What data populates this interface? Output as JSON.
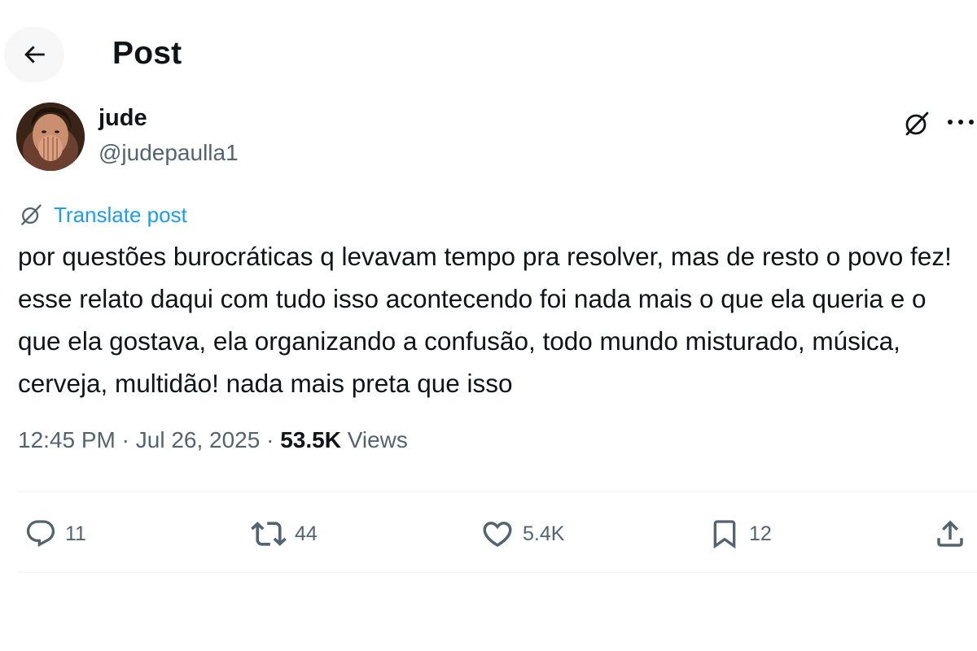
{
  "header": {
    "title": "Post",
    "back_icon": "arrow-left-icon"
  },
  "author": {
    "name": "jude",
    "handle": "@judepaulla1",
    "avatar": "profile-photo"
  },
  "toolbar": {
    "grok_icon": "grok-icon",
    "more_icon": "more-horizontal-icon"
  },
  "translate": {
    "label": "Translate post",
    "icon": "grok-icon"
  },
  "post": {
    "text": "por questões burocráticas q levavam tempo pra resolver, mas de resto o povo fez! esse relato daqui com tudo isso acontecendo foi nada mais o que ela queria e o que ela gostava, ela organizando a confusão, todo mundo misturado, música, cerveja, multidão! nada mais preta que isso"
  },
  "meta": {
    "time": "12:45 PM",
    "separator": "·",
    "date": "Jul 26, 2025",
    "views_count": "53.5K",
    "views_label": "Views"
  },
  "actions": [
    {
      "name": "reply",
      "icon": "reply-icon",
      "count": "11"
    },
    {
      "name": "repost",
      "icon": "repost-icon",
      "count": "44"
    },
    {
      "name": "like",
      "icon": "heart-icon",
      "count": "5.4K"
    },
    {
      "name": "bookmark",
      "icon": "bookmark-icon",
      "count": "12"
    },
    {
      "name": "share",
      "icon": "share-icon",
      "count": ""
    }
  ],
  "colors": {
    "accent": "#1d9bf0",
    "text": "#0f1419",
    "secondary": "#536471",
    "divider": "#eff3f4"
  }
}
